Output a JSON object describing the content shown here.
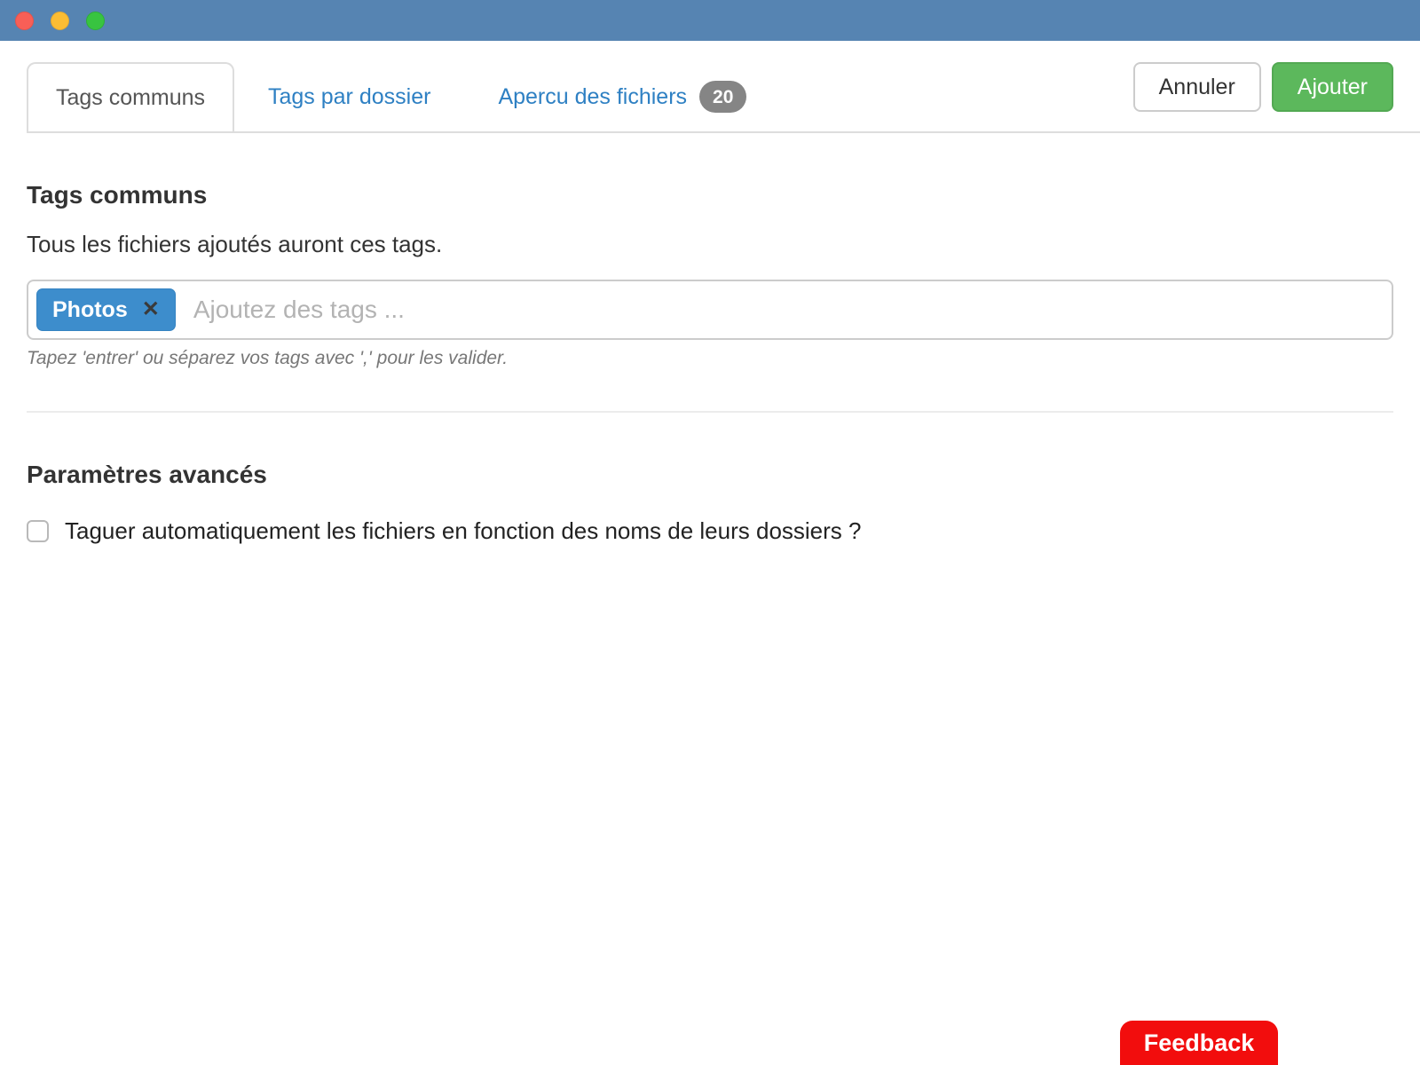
{
  "window": {
    "titlebar_color": "#5684b2",
    "traffic_lights": [
      "close",
      "minimize",
      "zoom"
    ]
  },
  "tabs": {
    "items": [
      {
        "label": "Tags communs",
        "active": true
      },
      {
        "label": "Tags par dossier",
        "active": false
      },
      {
        "label": "Apercu des fichiers",
        "active": false,
        "badge": "20"
      }
    ]
  },
  "actions": {
    "cancel_label": "Annuler",
    "add_label": "Ajouter",
    "add_color": "#5cb85c"
  },
  "common_tags": {
    "heading": "Tags communs",
    "description": "Tous les fichiers ajoutés auront ces tags.",
    "tags": [
      {
        "label": "Photos"
      }
    ],
    "remove_icon": "✕",
    "placeholder": "Ajoutez des tags ...",
    "hint": "Tapez 'entrer' ou séparez vos tags avec ',' pour les valider.",
    "tag_color": "#3d8dcc"
  },
  "advanced": {
    "heading": "Paramètres avancés",
    "checkbox_label": "Taguer automatiquement les fichiers en fonction des noms de leurs dossiers ?",
    "checked": false
  },
  "feedback": {
    "label": "Feedback",
    "color": "#f20d0d"
  }
}
